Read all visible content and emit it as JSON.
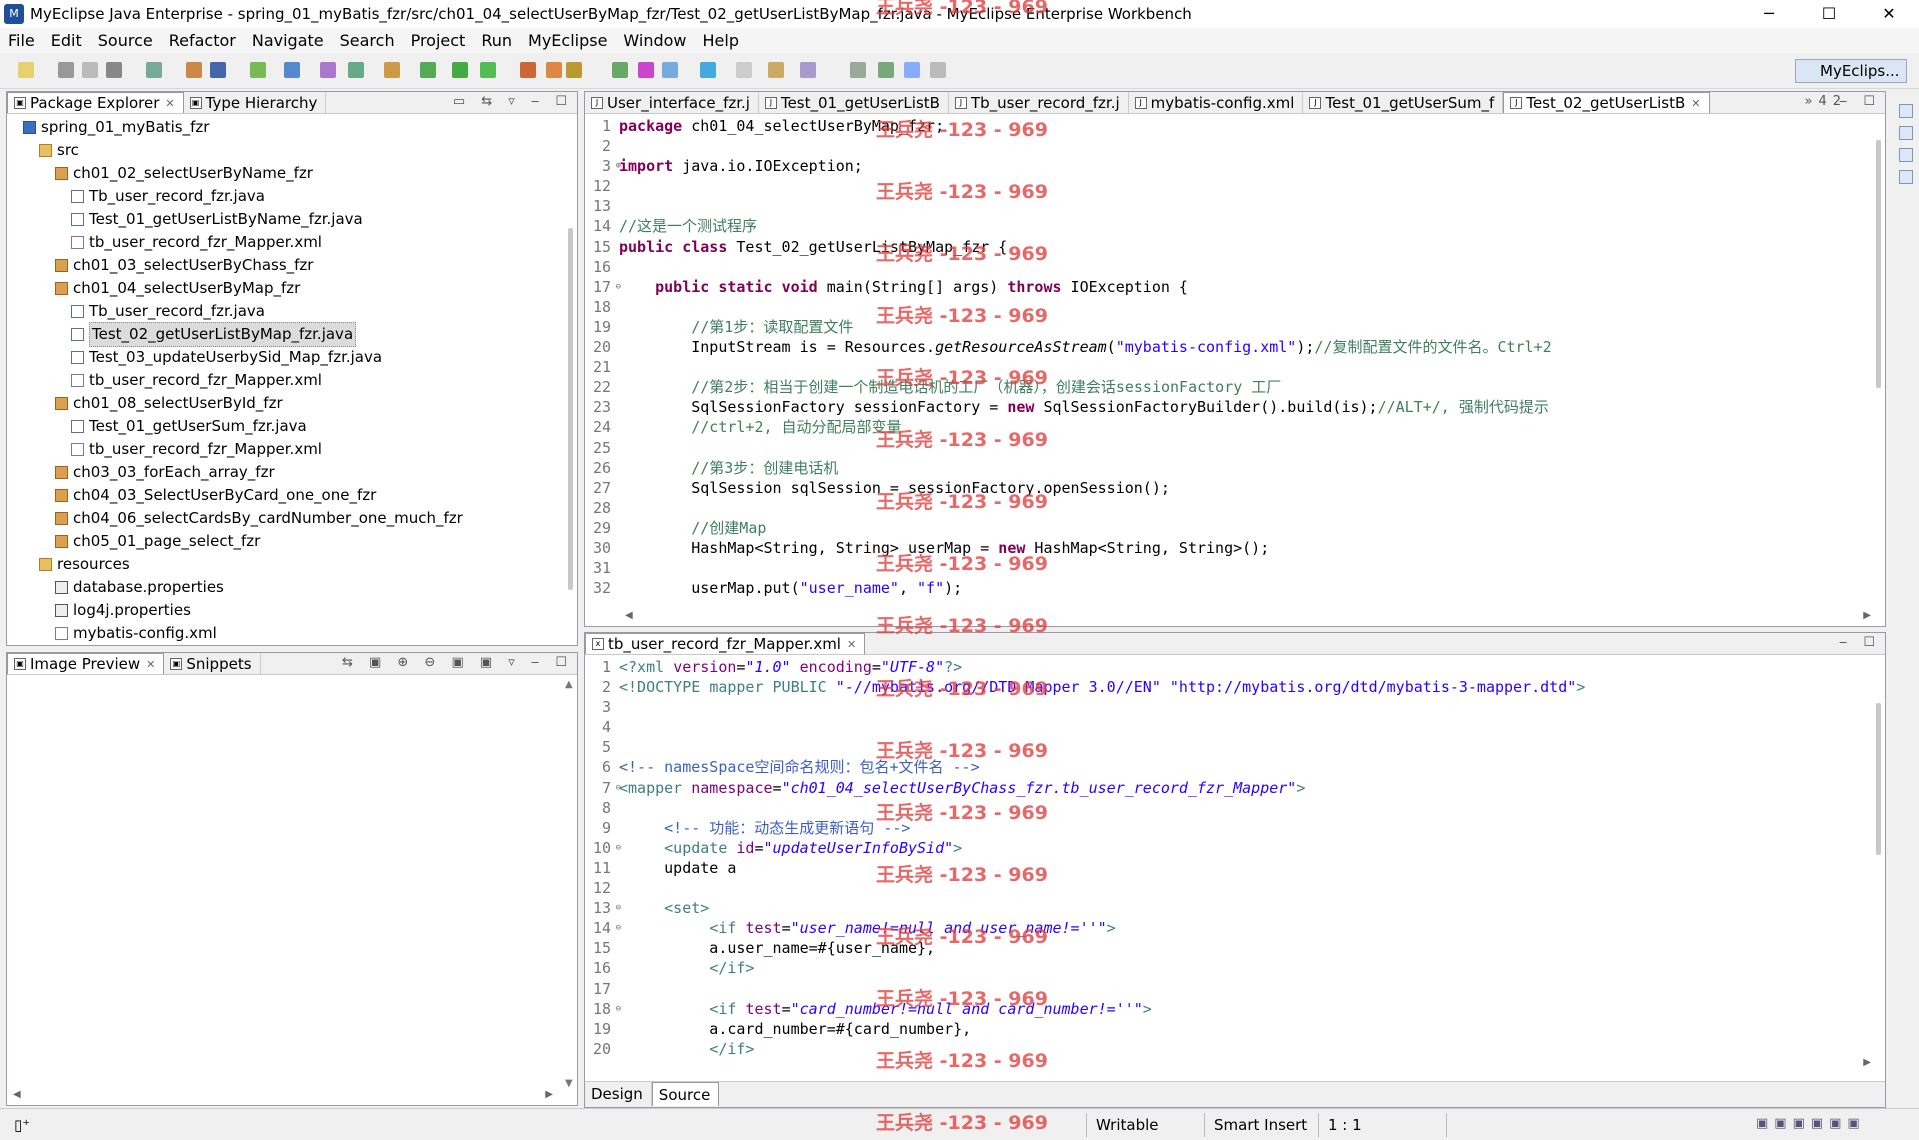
{
  "window": {
    "title": "MyEclipse Java Enterprise - spring_01_myBatis_fzr/src/ch01_04_selectUserByMap_fzr/Test_02_getUserListByMap_fzr.java - MyEclipse Enterprise Workbench",
    "minimize": "─",
    "maximize": "☐",
    "close": "✕"
  },
  "menu": [
    "File",
    "Edit",
    "Source",
    "Refactor",
    "Navigate",
    "Search",
    "Project",
    "Run",
    "MyEclipse",
    "Window",
    "Help"
  ],
  "perspective": "MyEclips...",
  "explorer": {
    "tabs": [
      {
        "label": "Package Explorer"
      },
      {
        "label": "Type Hierarchy"
      }
    ],
    "tree": [
      {
        "label": "spring_01_myBatis_fzr",
        "indent": 1,
        "icon": "proj"
      },
      {
        "label": "src",
        "indent": 2,
        "icon": "folder"
      },
      {
        "label": "ch01_02_selectUserByName_fzr",
        "indent": 3,
        "icon": "pkg"
      },
      {
        "label": "Tb_user_record_fzr.java",
        "indent": 4,
        "icon": "java"
      },
      {
        "label": "Test_01_getUserListByName_fzr.java",
        "indent": 4,
        "icon": "java"
      },
      {
        "label": "tb_user_record_fzr_Mapper.xml",
        "indent": 4,
        "icon": "xml"
      },
      {
        "label": "ch01_03_selectUserByChass_fzr",
        "indent": 3,
        "icon": "pkg"
      },
      {
        "label": "ch01_04_selectUserByMap_fzr",
        "indent": 3,
        "icon": "pkg"
      },
      {
        "label": "Tb_user_record_fzr.java",
        "indent": 4,
        "icon": "java"
      },
      {
        "label": "Test_02_getUserListByMap_fzr.java",
        "indent": 4,
        "icon": "java",
        "selected": true
      },
      {
        "label": "Test_03_updateUserbySid_Map_fzr.java",
        "indent": 4,
        "icon": "java"
      },
      {
        "label": "tb_user_record_fzr_Mapper.xml",
        "indent": 4,
        "icon": "xml"
      },
      {
        "label": "ch01_08_selectUserById_fzr",
        "indent": 3,
        "icon": "pkg"
      },
      {
        "label": "Test_01_getUserSum_fzr.java",
        "indent": 4,
        "icon": "java"
      },
      {
        "label": "tb_user_record_fzr_Mapper.xml",
        "indent": 4,
        "icon": "xml"
      },
      {
        "label": "ch03_03_forEach_array_fzr",
        "indent": 3,
        "icon": "pkg"
      },
      {
        "label": "ch04_03_SelectUserByCard_one_one_fzr",
        "indent": 3,
        "icon": "pkg"
      },
      {
        "label": "ch04_06_selectCardsBy_cardNumber_one_much_fzr",
        "indent": 3,
        "icon": "pkg"
      },
      {
        "label": "ch05_01_page_select_fzr",
        "indent": 3,
        "icon": "pkg"
      },
      {
        "label": "resources",
        "indent": 2,
        "icon": "folder"
      },
      {
        "label": "database.properties",
        "indent": 3,
        "icon": "prop"
      },
      {
        "label": "log4j.properties",
        "indent": 3,
        "icon": "prop"
      },
      {
        "label": "mybatis-config.xml",
        "indent": 3,
        "icon": "xml"
      }
    ]
  },
  "preview": {
    "tabs": [
      {
        "label": "Image Preview"
      },
      {
        "label": "Snippets"
      }
    ]
  },
  "editor": {
    "tabs": [
      {
        "label": "User_interface_fzr.j"
      },
      {
        "label": "Test_01_getUserListB"
      },
      {
        "label": "Tb_user_record_fzr.j"
      },
      {
        "label": "mybatis-config.xml"
      },
      {
        "label": "Test_01_getUserSum_f"
      },
      {
        "label": "Test_02_getUserListB",
        "active": true
      }
    ],
    "overflow": "»42",
    "lines": [
      {
        "n": "1",
        "html": "<span class=\"kw\">package</span> ch01_04_selectUserByMap_fzr;"
      },
      {
        "n": "2",
        "html": ""
      },
      {
        "n": "3",
        "fold": "⊕",
        "html": "<span class=\"kw\">import</span> java.io.IOException;"
      },
      {
        "n": "12",
        "html": ""
      },
      {
        "n": "13",
        "html": ""
      },
      {
        "n": "14",
        "html": "<span class=\"cm\">//这是一个测试程序</span>"
      },
      {
        "n": "15",
        "html": "<span class=\"kw\">public</span> <span class=\"kw\">class</span> Test_02_getUserListByMap_fzr {"
      },
      {
        "n": "16",
        "html": ""
      },
      {
        "n": "17",
        "fold": "⊖",
        "html": "    <span class=\"kw\">public</span> <span class=\"kw\">static</span> <span class=\"kw\">void</span> main(String[] args) <span class=\"kw\">throws</span> IOException {"
      },
      {
        "n": "18",
        "html": ""
      },
      {
        "n": "19",
        "html": "        <span class=\"cm\">//第1步：读取配置文件</span>"
      },
      {
        "n": "20",
        "html": "        InputStream is = Resources.<span class=\"it\">getResourceAsStream</span>(<span class=\"str\">\"mybatis-config.xml\"</span>);<span class=\"cm\">//复制配置文件的文件名。Ctrl+2</span>"
      },
      {
        "n": "21",
        "html": ""
      },
      {
        "n": "22",
        "html": "        <span class=\"cm\">//第2步：相当于创建一个制造电话机的工厂（机器），创建会话sessionFactory 工厂</span>"
      },
      {
        "n": "23",
        "html": "        SqlSessionFactory sessionFactory = <span class=\"kw\">new</span> SqlSessionFactoryBuilder().build(is);<span class=\"cm\">//ALT+/, 强制代码提示</span>"
      },
      {
        "n": "24",
        "html": "        <span class=\"cm\">//ctrl+2, 自动分配局部变量</span>"
      },
      {
        "n": "25",
        "html": ""
      },
      {
        "n": "26",
        "html": "        <span class=\"cm\">//第3步：创建电话机</span>"
      },
      {
        "n": "27",
        "html": "        SqlSession sqlSession = sessionFactory.openSession();"
      },
      {
        "n": "28",
        "html": ""
      },
      {
        "n": "29",
        "html": "        <span class=\"cm\">//创建Map</span>"
      },
      {
        "n": "30",
        "html": "        HashMap&lt;String, String&gt; userMap = <span class=\"kw\">new</span> HashMap&lt;String, String&gt;();"
      },
      {
        "n": "31",
        "html": ""
      },
      {
        "n": "32",
        "html": "        userMap.put(<span class=\"str\">\"user_name\"</span>, <span class=\"str\">\"f\"</span>);"
      }
    ]
  },
  "xmleditor": {
    "tab": "tb_user_record_fzr_Mapper.xml",
    "lines": [
      {
        "n": "1",
        "html": "<span class=\"xmlkw\">&lt;?xml</span> <span class=\"xmlattr\">version</span>=<span class=\"xmlval\">\"1.0\"</span> <span class=\"xmlattr\">encoding</span>=<span class=\"xmlval\">\"UTF-8\"</span><span class=\"xmlkw\">?&gt;</span>"
      },
      {
        "n": "2",
        "html": "<span class=\"xmlkw\">&lt;!DOCTYPE</span> <span class=\"xmlkw\">mapper</span> <span class=\"xmlkw\">PUBLIC</span> <span class=\"str\">\"-//mybatis.org//DTD Mapper 3.0//EN\"</span> <span class=\"str\">\"http://mybatis.org/dtd/mybatis-3-mapper.dtd\"</span><span class=\"xmlkw\">&gt;</span>"
      },
      {
        "n": "3",
        "html": ""
      },
      {
        "n": "4",
        "html": ""
      },
      {
        "n": "5",
        "html": ""
      },
      {
        "n": "6",
        "html": "<span class=\"xmlcm\">&lt;!-- namesSpace空间命名规则：包名+文件名 --&gt;</span>"
      },
      {
        "n": "7",
        "fold": "⊖",
        "html": "<span class=\"xmlkw\">&lt;mapper</span> <span class=\"xmlattr\">namespace</span>=<span class=\"xmlval\">\"ch01_04_selectUserByChass_fzr.tb_user_record_fzr_Mapper\"</span><span class=\"xmlkw\">&gt;</span>"
      },
      {
        "n": "8",
        "html": ""
      },
      {
        "n": "9",
        "html": "     <span class=\"xmlcm\">&lt;!-- 功能：动态生成更新语句 --&gt;</span>"
      },
      {
        "n": "10",
        "fold": "⊖",
        "html": "     <span class=\"xmlkw\">&lt;update</span> <span class=\"xmlattr\">id</span>=<span class=\"xmlval\">\"updateUserInfoBySid\"</span><span class=\"xmlkw\">&gt;</span>"
      },
      {
        "n": "11",
        "html": "     update a"
      },
      {
        "n": "12",
        "html": ""
      },
      {
        "n": "13",
        "fold": "⊖",
        "html": "     <span class=\"xmlkw\">&lt;set&gt;</span>"
      },
      {
        "n": "14",
        "fold": "⊖",
        "html": "          <span class=\"xmlkw\">&lt;if</span> <span class=\"xmlattr\">test</span>=<span class=\"xmlval\">\"user_name!=null and user_name!=''\"</span><span class=\"xmlkw\">&gt;</span>"
      },
      {
        "n": "15",
        "html": "          a.user_name=#{user_name},"
      },
      {
        "n": "16",
        "html": "          <span class=\"xmlkw\">&lt;/if&gt;</span>"
      },
      {
        "n": "17",
        "html": ""
      },
      {
        "n": "18",
        "fold": "⊖",
        "html": "          <span class=\"xmlkw\">&lt;if</span> <span class=\"xmlattr\">test</span>=<span class=\"xmlval\">\"card_number!=null and card_number!=''\"</span><span class=\"xmlkw\">&gt;</span>"
      },
      {
        "n": "19",
        "html": "          a.card_number=#{card_number},"
      },
      {
        "n": "20",
        "html": "          <span class=\"xmlkw\">&lt;/if&gt;</span>"
      }
    ],
    "bottom_tabs": [
      "Design",
      "Source"
    ]
  },
  "watermark": "王兵尧 -123 - 969",
  "status": {
    "mode": "Writable",
    "insert": "Smart Insert",
    "position": "1 : 1"
  }
}
